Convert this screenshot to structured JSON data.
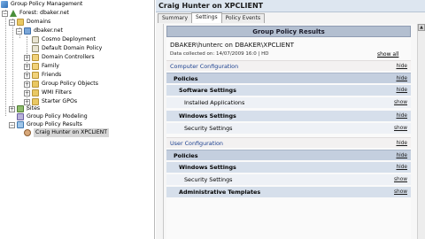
{
  "tree": {
    "root": "Group Policy Management",
    "forest": "Forest: dbaker.net",
    "domains": "Domains",
    "domain": "dbaker.net",
    "domain_children": [
      "Cosmo Deployment",
      "Default Domain Policy",
      "Domain Controllers",
      "Family",
      "Friends",
      "Group Policy Objects",
      "WMI Filters",
      "Starter GPOs"
    ],
    "sites": "Sites",
    "modeling": "Group Policy Modeling",
    "results": "Group Policy Results",
    "selected": "Craig Hunter on XPCLIENT",
    "expanders": {
      "minus": "−",
      "plus": "+"
    }
  },
  "right": {
    "title": "Craig Hunter on XPCLIENT",
    "tabs": [
      "Summary",
      "Settings",
      "Policy Events"
    ],
    "active_tab": "Settings"
  },
  "report": {
    "header": "Group Policy Results",
    "subject": "DBAKER\\hunterc on DBAKER\\XPCLIENT",
    "date_line": "Data collected on: 14/07/2009 16:0 | HD",
    "show_all": "show all",
    "sections": [
      {
        "label": "Computer Configuration",
        "action": "hide",
        "level": 0
      },
      {
        "label": "Policies",
        "action": "hide",
        "level": 1
      },
      {
        "label": "Software Settings",
        "action": "hide",
        "level": 2
      },
      {
        "label": "Installed Applications",
        "action": "show",
        "level": 3
      },
      {
        "label": "Windows Settings",
        "action": "hide",
        "level": 2
      },
      {
        "label": "Security Settings",
        "action": "show",
        "level": 3
      },
      {
        "label": "User Configuration",
        "action": "hide",
        "level": 0
      },
      {
        "label": "Policies",
        "action": "hide",
        "level": 1
      },
      {
        "label": "Windows Settings",
        "action": "hide",
        "level": 2
      },
      {
        "label": "Security Settings",
        "action": "show",
        "level": 3
      },
      {
        "label": "Administrative Templates",
        "action": "show",
        "level": 2
      }
    ]
  },
  "colors": {
    "header_bar": "#b3bfd0",
    "level1": "#c4cfdf",
    "level2": "#d6dfeb",
    "level3": "#eef1f6",
    "config_text": "#1a3f8f"
  }
}
